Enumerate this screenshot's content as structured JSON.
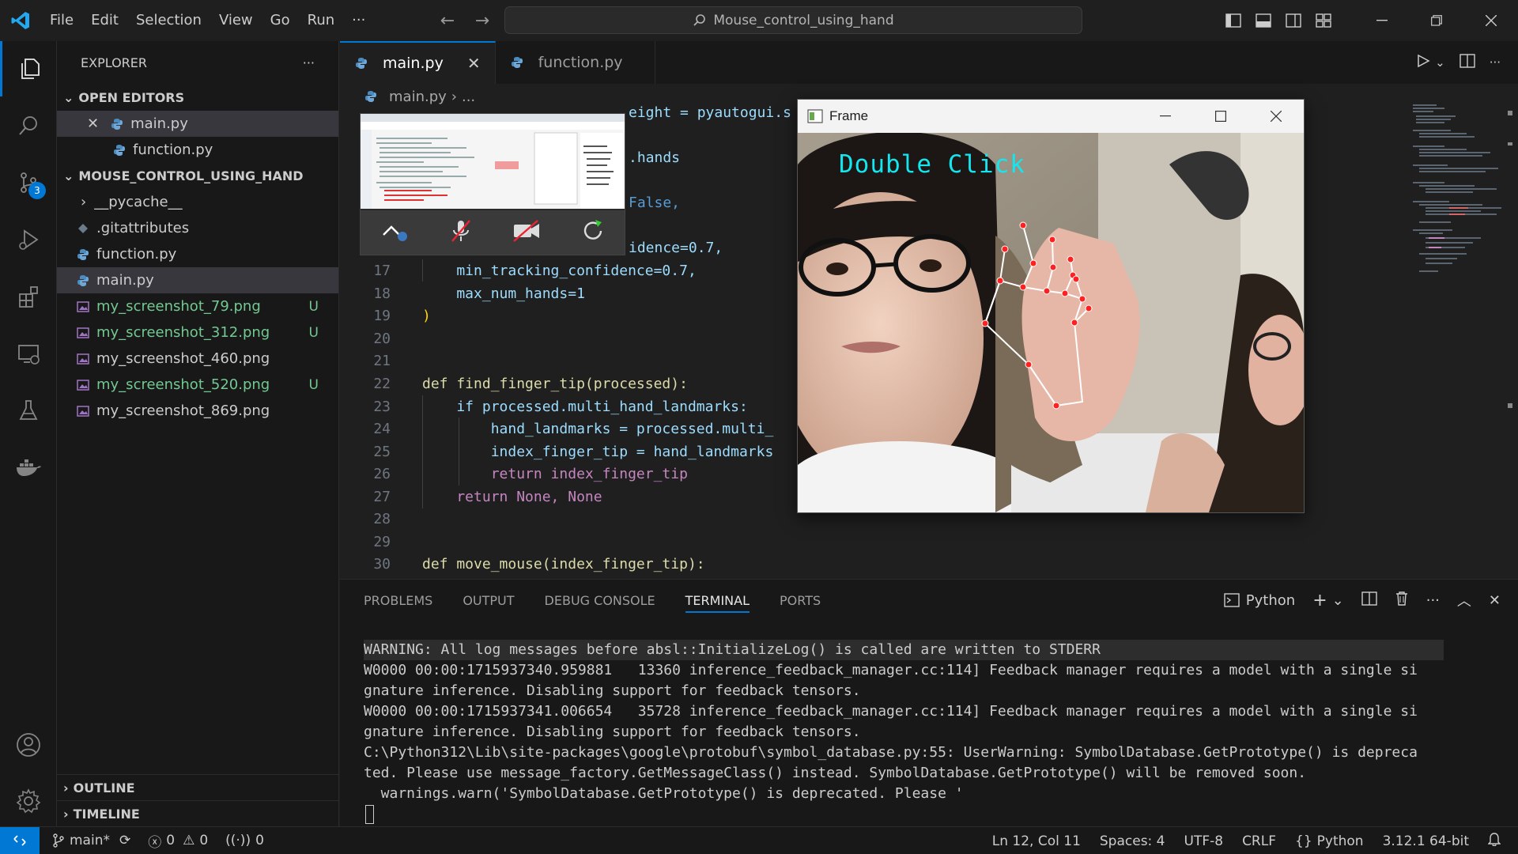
{
  "menu": [
    "File",
    "Edit",
    "Selection",
    "View",
    "Go",
    "Run",
    "···"
  ],
  "search": {
    "text": "Mouse_control_using_hand"
  },
  "activity": {
    "source_control_badge": "3"
  },
  "sidebar": {
    "title": "EXPLORER",
    "more": "···",
    "open_editors_title": "OPEN EDITORS",
    "open_editors": [
      {
        "name": "main.py"
      },
      {
        "name": "function.py"
      }
    ],
    "project_title": "MOUSE_CONTROL_USING_HAND",
    "files": [
      {
        "name": "__pycache__",
        "git": ""
      },
      {
        "name": ".gitattributes",
        "git": ""
      },
      {
        "name": "function.py",
        "git": ""
      },
      {
        "name": "main.py",
        "git": ""
      },
      {
        "name": "my_screenshot_79.png",
        "git": "U"
      },
      {
        "name": "my_screenshot_312.png",
        "git": "U"
      },
      {
        "name": "my_screenshot_460.png",
        "git": ""
      },
      {
        "name": "my_screenshot_520.png",
        "git": "U"
      },
      {
        "name": "my_screenshot_869.png",
        "git": ""
      }
    ],
    "outline_title": "OUTLINE",
    "timeline_title": "TIMELINE"
  },
  "tabs": [
    {
      "label": "main.py"
    },
    {
      "label": "function.py"
    }
  ],
  "breadcrumb": {
    "file": "main.py",
    "rest": "..."
  },
  "code": {
    "partial_top_1": "eight = pyautogui.s",
    "partial_top_2": ".hands",
    "partial_top_3": "False,",
    "partial_top_4": "idence=0.7,",
    "lines": [
      {
        "n": "17",
        "text": "    min_tracking_confidence=0.7,"
      },
      {
        "n": "18",
        "text": "    max_num_hands=1"
      },
      {
        "n": "19",
        "text": ")"
      },
      {
        "n": "20",
        "text": ""
      },
      {
        "n": "21",
        "text": ""
      },
      {
        "n": "22",
        "text": "def find_finger_tip(processed):"
      },
      {
        "n": "23",
        "text": "    if processed.multi_hand_landmarks:"
      },
      {
        "n": "24",
        "text": "        hand_landmarks = processed.multi_"
      },
      {
        "n": "25",
        "text": "        index_finger_tip = hand_landmarks"
      },
      {
        "n": "26",
        "text": "        return index_finger_tip"
      },
      {
        "n": "27",
        "text": "    return None, None"
      },
      {
        "n": "28",
        "text": ""
      },
      {
        "n": "29",
        "text": ""
      },
      {
        "n": "30",
        "text": "def move_mouse(index_finger_tip):"
      }
    ]
  },
  "frame": {
    "title": "Frame",
    "overlay_text": "Double Click"
  },
  "panel": {
    "tabs": [
      "PROBLEMS",
      "OUTPUT",
      "DEBUG CONSOLE",
      "TERMINAL",
      "PORTS"
    ],
    "active_tab": "TERMINAL",
    "terminal_label": "Python",
    "terminal_lines": [
      "WARNING: All log messages before absl::InitializeLog() is called are written to STDERR",
      "W0000 00:00:1715937340.959881   13360 inference_feedback_manager.cc:114] Feedback manager requires a model with a single si",
      "gnature inference. Disabling support for feedback tensors.",
      "W0000 00:00:1715937341.006654   35728 inference_feedback_manager.cc:114] Feedback manager requires a model with a single si",
      "gnature inference. Disabling support for feedback tensors.",
      "C:\\Python312\\Lib\\site-packages\\google\\protobuf\\symbol_database.py:55: UserWarning: SymbolDatabase.GetPrototype() is depreca",
      "ted. Please use message_factory.GetMessageClass() instead. SymbolDatabase.GetPrototype() will be removed soon.",
      "  warnings.warn('SymbolDatabase.GetPrototype() is deprecated. Please '"
    ]
  },
  "status": {
    "branch": "main*",
    "errors": "0",
    "warnings": "0",
    "ports": "0",
    "position": "Ln 12, Col 11",
    "spaces": "Spaces: 4",
    "encoding": "UTF-8",
    "eol": "CRLF",
    "language": "Python",
    "interpreter": "3.12.1 64-bit"
  },
  "colors": {
    "accent": "#0078d4",
    "untracked": "#73c991",
    "overlay_text": "#14e6f0",
    "landmark": "#ff2020"
  }
}
